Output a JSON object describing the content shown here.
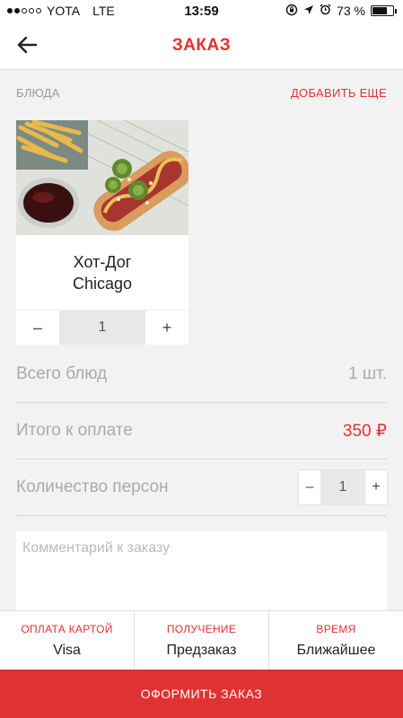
{
  "status_bar": {
    "carrier": "YOTA",
    "network": "LTE",
    "time": "13:59",
    "battery": "73 %",
    "battery_level": 0.73,
    "signal_bars_filled": 2,
    "signal_bars_total": 5
  },
  "nav": {
    "title": "ЗАКАЗ",
    "back_icon": "arrow-left-icon"
  },
  "dishes_section": {
    "label": "БЛЮДА",
    "add_more": "ДОБАВИТЬ ЕЩЕ"
  },
  "dish": {
    "name": "Хот-Дог\nChicago",
    "quantity": "1",
    "minus": "–",
    "plus": "+"
  },
  "summary": {
    "total_dishes_label": "Всего блюд",
    "total_dishes_value": "1 шт.",
    "total_pay_label": "Итого к оплате",
    "total_pay_value": "350 ₽",
    "persons_label": "Количество персон",
    "persons_value": "1",
    "minus": "–",
    "plus": "+"
  },
  "comment": {
    "placeholder": "Комментарий к заказу",
    "value": ""
  },
  "options": [
    {
      "label": "ОПЛАТА КАРТОЙ",
      "value": "Visa"
    },
    {
      "label": "ПОЛУЧЕНИЕ",
      "value": "Предзаказ"
    },
    {
      "label": "ВРЕМЯ",
      "value": "Ближайшее"
    }
  ],
  "submit_label": "ОФОРМИТЬ ЗАКАЗ",
  "colors": {
    "accent": "#e03232",
    "background": "#f2f2f2"
  }
}
